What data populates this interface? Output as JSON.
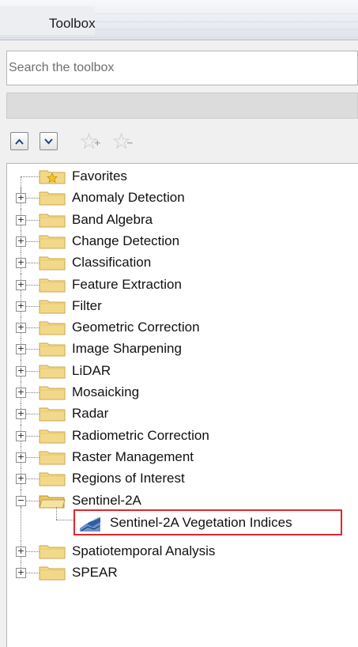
{
  "panel": {
    "title": "Toolbox"
  },
  "search": {
    "placeholder": "Search the toolbox",
    "value": ""
  },
  "toolbar": {
    "move_up_icon": "chevron-up-icon",
    "move_down_icon": "chevron-down-icon",
    "add_favorite_icon": "star-add-icon",
    "remove_favorite_icon": "star-remove-icon"
  },
  "tree": {
    "items": [
      {
        "label": "Favorites",
        "expandable": false,
        "icon": "favorites-folder-icon"
      },
      {
        "label": "Anomaly Detection",
        "expandable": true,
        "icon": "folder-icon"
      },
      {
        "label": "Band Algebra",
        "expandable": true,
        "icon": "folder-icon"
      },
      {
        "label": "Change Detection",
        "expandable": true,
        "icon": "folder-icon"
      },
      {
        "label": "Classification",
        "expandable": true,
        "icon": "folder-icon"
      },
      {
        "label": "Feature Extraction",
        "expandable": true,
        "icon": "folder-icon"
      },
      {
        "label": "Filter",
        "expandable": true,
        "icon": "folder-icon"
      },
      {
        "label": "Geometric Correction",
        "expandable": true,
        "icon": "folder-icon"
      },
      {
        "label": "Image Sharpening",
        "expandable": true,
        "icon": "folder-icon"
      },
      {
        "label": "LiDAR",
        "expandable": true,
        "icon": "folder-icon"
      },
      {
        "label": "Mosaicking",
        "expandable": true,
        "icon": "folder-icon"
      },
      {
        "label": "Radar",
        "expandable": true,
        "icon": "folder-icon"
      },
      {
        "label": "Radiometric Correction",
        "expandable": true,
        "icon": "folder-icon"
      },
      {
        "label": "Raster Management",
        "expandable": true,
        "icon": "folder-icon"
      },
      {
        "label": "Regions of Interest",
        "expandable": true,
        "icon": "folder-icon"
      },
      {
        "label": "Sentinel-2A",
        "expandable": true,
        "expanded": true,
        "icon": "open-folder-icon",
        "children": [
          {
            "label": "Sentinel-2A Vegetation Indices",
            "icon": "vegetation-tool-icon",
            "highlighted": true
          }
        ]
      },
      {
        "label": "Spatiotemporal Analysis",
        "expandable": true,
        "icon": "folder-icon"
      },
      {
        "label": "SPEAR",
        "expandable": true,
        "icon": "folder-icon"
      }
    ]
  },
  "colors": {
    "folder_fill": "#f2d98a",
    "folder_edge": "#c9a64a",
    "highlight_border": "#e0262f"
  }
}
